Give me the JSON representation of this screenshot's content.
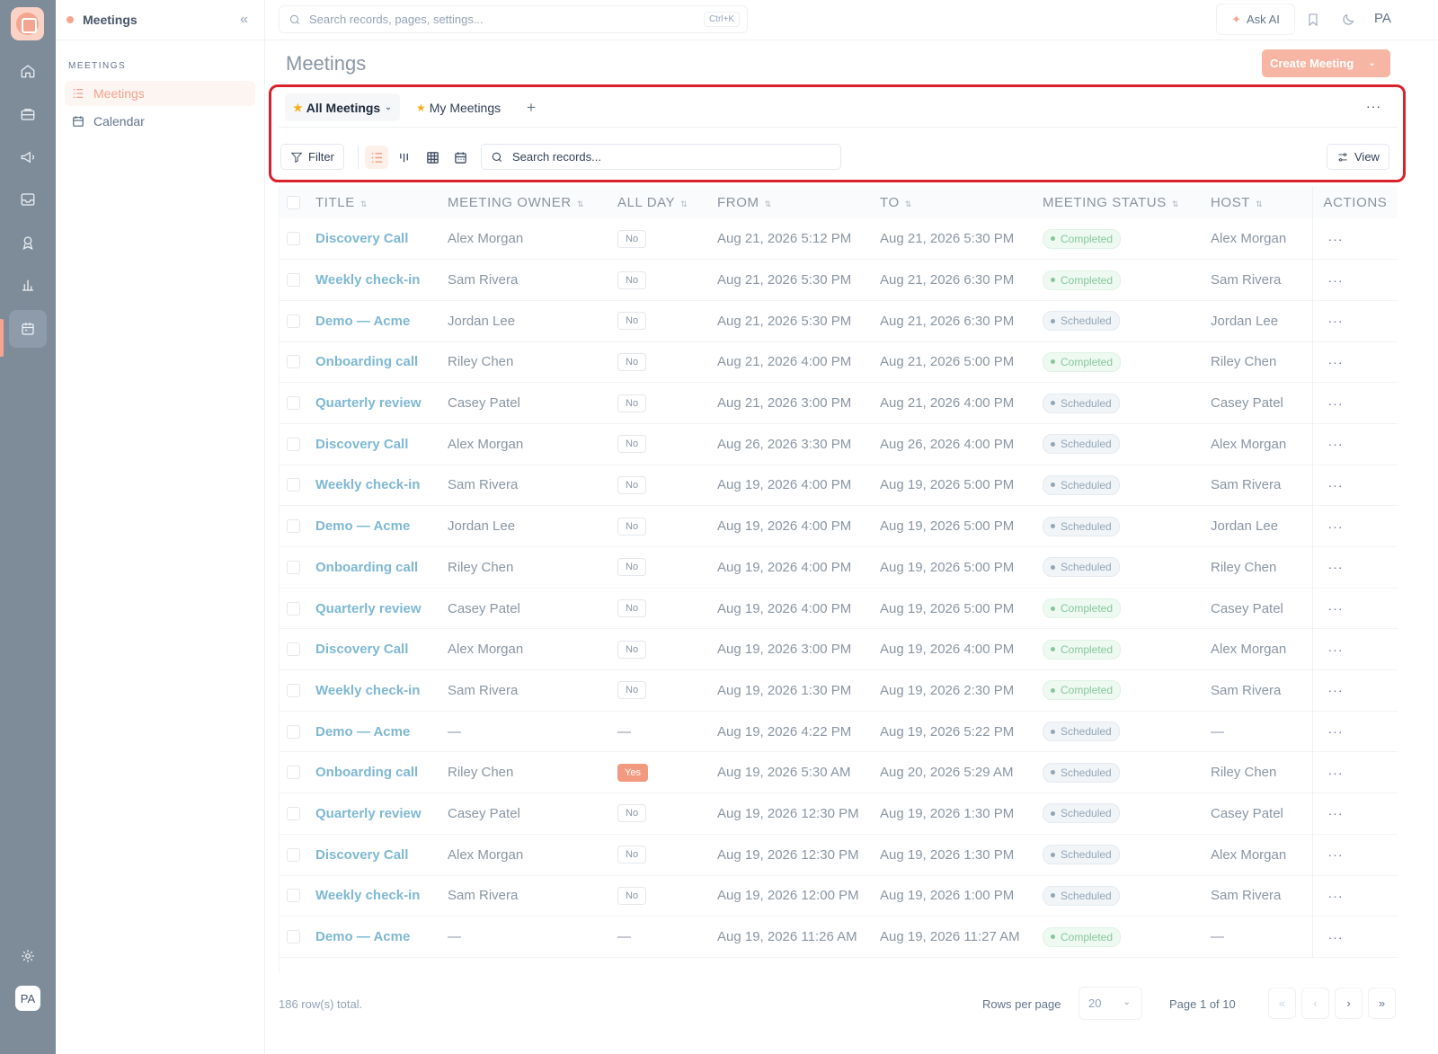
{
  "app": {
    "user_initials": "PA"
  },
  "sidebar": {
    "title": "Meetings",
    "section_label": "MEETINGS",
    "items": [
      {
        "label": "Meetings",
        "icon": "list-icon",
        "active": true
      },
      {
        "label": "Calendar",
        "icon": "calendar-icon",
        "active": false
      }
    ]
  },
  "topbar": {
    "search_placeholder": "Search records, pages, settings...",
    "shortcut": "Ctrl+K",
    "ask_ai": "Ask AI",
    "user_initials": "PA"
  },
  "page": {
    "title": "Meetings",
    "create_button": "Create Meeting"
  },
  "views": {
    "tabs": [
      {
        "label": "All Meetings",
        "starred": true,
        "active": true
      },
      {
        "label": "My Meetings",
        "starred": true,
        "active": false
      }
    ],
    "add": "+",
    "more": "···"
  },
  "toolbar": {
    "filter_label": "Filter",
    "search_placeholder": "Search records...",
    "view_label": "View"
  },
  "table": {
    "columns": [
      "TITLE",
      "MEETING OWNER",
      "ALL DAY",
      "FROM",
      "TO",
      "MEETING STATUS",
      "HOST",
      "ACTIONS"
    ],
    "rows": [
      {
        "title": "Discovery Call",
        "owner": "Alex Morgan",
        "all_day": "No",
        "from": "Aug 21, 2026 5:12 PM",
        "to": "Aug 21, 2026 5:30 PM",
        "status": "Completed",
        "host": "Alex Morgan"
      },
      {
        "title": "Weekly check-in",
        "owner": "Sam Rivera",
        "all_day": "No",
        "from": "Aug 21, 2026 5:30 PM",
        "to": "Aug 21, 2026 6:30 PM",
        "status": "Completed",
        "host": "Sam Rivera"
      },
      {
        "title": "Demo — Acme",
        "owner": "Jordan Lee",
        "all_day": "No",
        "from": "Aug 21, 2026 5:30 PM",
        "to": "Aug 21, 2026 6:30 PM",
        "status": "Scheduled",
        "host": "Jordan Lee"
      },
      {
        "title": "Onboarding call",
        "owner": "Riley Chen",
        "all_day": "No",
        "from": "Aug 21, 2026 4:00 PM",
        "to": "Aug 21, 2026 5:00 PM",
        "status": "Completed",
        "host": "Riley Chen"
      },
      {
        "title": "Quarterly review",
        "owner": "Casey Patel",
        "all_day": "No",
        "from": "Aug 21, 2026 3:00 PM",
        "to": "Aug 21, 2026 4:00 PM",
        "status": "Scheduled",
        "host": "Casey Patel"
      },
      {
        "title": "Discovery Call",
        "owner": "Alex Morgan",
        "all_day": "No",
        "from": "Aug 26, 2026 3:30 PM",
        "to": "Aug 26, 2026 4:00 PM",
        "status": "Scheduled",
        "host": "Alex Morgan"
      },
      {
        "title": "Weekly check-in",
        "owner": "Sam Rivera",
        "all_day": "No",
        "from": "Aug 19, 2026 4:00 PM",
        "to": "Aug 19, 2026 5:00 PM",
        "status": "Scheduled",
        "host": "Sam Rivera"
      },
      {
        "title": "Demo — Acme",
        "owner": "Jordan Lee",
        "all_day": "No",
        "from": "Aug 19, 2026 4:00 PM",
        "to": "Aug 19, 2026 5:00 PM",
        "status": "Scheduled",
        "host": "Jordan Lee"
      },
      {
        "title": "Onboarding call",
        "owner": "Riley Chen",
        "all_day": "No",
        "from": "Aug 19, 2026 4:00 PM",
        "to": "Aug 19, 2026 5:00 PM",
        "status": "Scheduled",
        "host": "Riley Chen"
      },
      {
        "title": "Quarterly review",
        "owner": "Casey Patel",
        "all_day": "No",
        "from": "Aug 19, 2026 4:00 PM",
        "to": "Aug 19, 2026 5:00 PM",
        "status": "Completed",
        "host": "Casey Patel"
      },
      {
        "title": "Discovery Call",
        "owner": "Alex Morgan",
        "all_day": "No",
        "from": "Aug 19, 2026 3:00 PM",
        "to": "Aug 19, 2026 4:00 PM",
        "status": "Completed",
        "host": "Alex Morgan"
      },
      {
        "title": "Weekly check-in",
        "owner": "Sam Rivera",
        "all_day": "No",
        "from": "Aug 19, 2026 1:30 PM",
        "to": "Aug 19, 2026 2:30 PM",
        "status": "Completed",
        "host": "Sam Rivera"
      },
      {
        "title": "Demo — Acme",
        "owner": "—",
        "all_day": "—",
        "from": "Aug 19, 2026 4:22 PM",
        "to": "Aug 19, 2026 5:22 PM",
        "status": "Scheduled",
        "host": "—"
      },
      {
        "title": "Onboarding call",
        "owner": "Riley Chen",
        "all_day": "Yes",
        "from": "Aug 19, 2026 5:30 AM",
        "to": "Aug 20, 2026 5:29 AM",
        "status": "Scheduled",
        "host": "Riley Chen"
      },
      {
        "title": "Quarterly review",
        "owner": "Casey Patel",
        "all_day": "No",
        "from": "Aug 19, 2026 12:30 PM",
        "to": "Aug 19, 2026 1:30 PM",
        "status": "Scheduled",
        "host": "Casey Patel"
      },
      {
        "title": "Discovery Call",
        "owner": "Alex Morgan",
        "all_day": "No",
        "from": "Aug 19, 2026 12:30 PM",
        "to": "Aug 19, 2026 1:30 PM",
        "status": "Scheduled",
        "host": "Alex Morgan"
      },
      {
        "title": "Weekly check-in",
        "owner": "Sam Rivera",
        "all_day": "No",
        "from": "Aug 19, 2026 12:00 PM",
        "to": "Aug 19, 2026 1:00 PM",
        "status": "Scheduled",
        "host": "Sam Rivera"
      },
      {
        "title": "Demo — Acme",
        "owner": "—",
        "all_day": "—",
        "from": "Aug 19, 2026 11:26 AM",
        "to": "Aug 19, 2026 11:27 AM",
        "status": "Completed",
        "host": "—"
      }
    ],
    "row_action": "···"
  },
  "footer": {
    "total": "186 row(s) total.",
    "rows_per_page_label": "Rows per page",
    "rows_per_page": "20",
    "page_info": "Page 1 of 10",
    "first": "«",
    "prev": "‹",
    "next": "›",
    "last": "»"
  },
  "colors": {
    "accent": "#f4a58f",
    "link": "#7eb8d3",
    "highlight_border": "#d9212c",
    "rail": "#7e8c9a"
  }
}
